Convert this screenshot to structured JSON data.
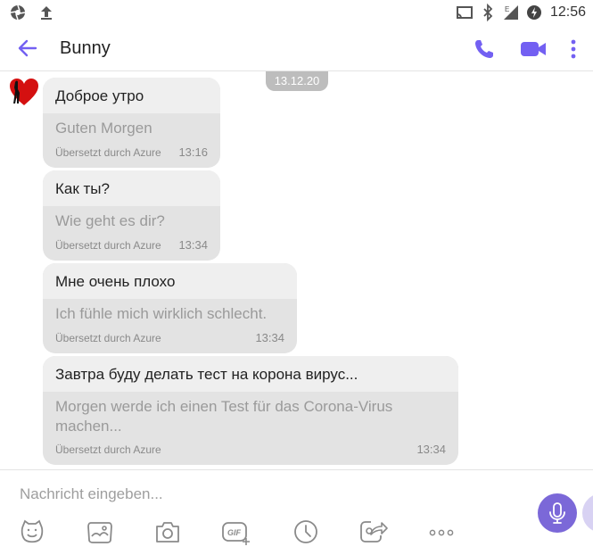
{
  "status_bar": {
    "time": "12:56",
    "left_icons": [
      "aperture-icon",
      "upload-icon"
    ],
    "right_icons": [
      "cast-icon",
      "bluetooth-icon",
      "signal-e-icon",
      "battery-charging-icon"
    ]
  },
  "app_bar": {
    "title": "Bunny",
    "actions": [
      "phone-icon",
      "video-camera-icon",
      "more-vertical-icon"
    ],
    "accent_color": "#7360f2"
  },
  "conversation": {
    "date": "13.12.20",
    "messages": [
      {
        "original": "Доброе утро",
        "translation": "Guten Morgen",
        "via": "Übersetzt durch Azure",
        "time": "13:16"
      },
      {
        "original": "Как ты?",
        "translation": "Wie geht es dir?",
        "via": "Übersetzt durch Azure",
        "time": "13:34"
      },
      {
        "original": "Мне очень плохо",
        "translation": "Ich fühle mich wirklich schlecht.",
        "via": "Übersetzt durch Azure",
        "time": "13:34"
      },
      {
        "original": "Завтра буду делать тест на корона вирус...",
        "translation_line1": "Morgen werde ich einen Test für das Corona-Virus",
        "translation_line2": "machen...",
        "via": "Übersetzt durch Azure",
        "time": "13:34"
      }
    ]
  },
  "composer": {
    "placeholder": "Nachricht eingeben...",
    "toolbar": [
      "sticker-icon",
      "gallery-icon",
      "camera-icon",
      "gif-icon",
      "timer-icon",
      "share-icon",
      "more-horizontal-icon"
    ],
    "mic_icon": "microphone-icon",
    "mic_color": "#7b68d8"
  }
}
